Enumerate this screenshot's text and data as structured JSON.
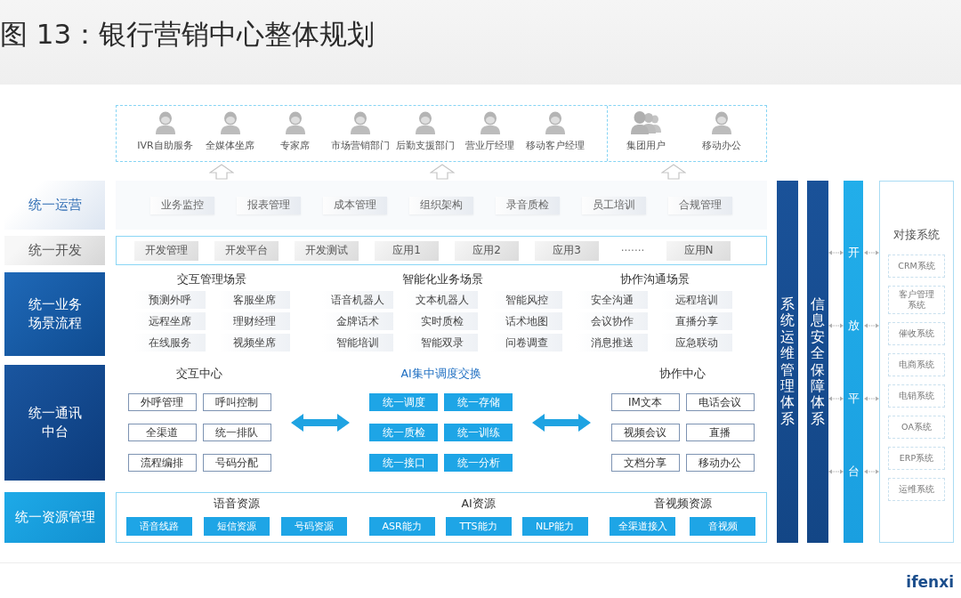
{
  "title": "图 13：银行营销中心整体规划",
  "user_groups": [
    {
      "users": [
        {
          "label": "IVR自助服务",
          "kind": "person"
        },
        {
          "label": "全媒体坐席",
          "kind": "person"
        },
        {
          "label": "专家席",
          "kind": "person"
        },
        {
          "label": "市场营销部门",
          "kind": "person"
        },
        {
          "label": "后勤支援部门",
          "kind": "person"
        },
        {
          "label": "营业厅经理",
          "kind": "person"
        },
        {
          "label": "移动客户经理",
          "kind": "person"
        }
      ]
    },
    {
      "users": [
        {
          "label": "集团用户",
          "kind": "group"
        },
        {
          "label": "移动办公",
          "kind": "person"
        }
      ]
    }
  ],
  "layers": [
    {
      "kind": "ops",
      "label": "统一运营",
      "items": [
        "业务监控",
        "报表管理",
        "成本管理",
        "组织架构",
        "录音质检",
        "员工培训",
        "合规管理"
      ]
    },
    {
      "kind": "dev",
      "label": "统一开发",
      "items": [
        {
          "text": "开发管理",
          "kind": "tile"
        },
        {
          "text": "开发平台",
          "kind": "tile"
        },
        {
          "text": "开发测试",
          "kind": "tile"
        },
        {
          "text": "应用1",
          "kind": "tile"
        },
        {
          "text": "应用2",
          "kind": "tile"
        },
        {
          "text": "应用3",
          "kind": "tile"
        },
        {
          "text": "·······",
          "kind": "gap"
        },
        {
          "text": "应用N",
          "kind": "tile"
        }
      ]
    },
    {
      "kind": "scenes",
      "label": "统一业务场景流程",
      "groups": [
        {
          "title": "交互管理场景",
          "rows": [
            [
              "预测外呼",
              "客服坐席"
            ],
            [
              "远程坐席",
              "理财经理"
            ],
            [
              "在线服务",
              "视频坐席"
            ]
          ]
        },
        {
          "title": "智能化业务场景",
          "rows": [
            [
              "语音机器人",
              "文本机器人",
              "智能风控"
            ],
            [
              "金牌话术",
              "实时质检",
              "话术地图"
            ],
            [
              "智能培训",
              "智能双录",
              "问卷调查"
            ]
          ]
        },
        {
          "title": "协作沟通场景",
          "rows": [
            [
              "安全沟通",
              "远程培训"
            ],
            [
              "会议协作",
              "直播分享"
            ],
            [
              "消息推送",
              "应急联动"
            ]
          ]
        }
      ]
    },
    {
      "kind": "comm",
      "label": "统一通讯中台",
      "groups": [
        {
          "title": "交互中心",
          "kind": "outline",
          "rows": [
            [
              "外呼管理",
              "呼叫控制"
            ],
            [
              "全渠道",
              "统一排队"
            ],
            [
              "流程编排",
              "号码分配"
            ]
          ]
        },
        {
          "title": "AI集中调度交换",
          "kind": "filled",
          "rows": [
            [
              "统一调度",
              "统一存储"
            ],
            [
              "统一质检",
              "统一训练"
            ],
            [
              "统一接口",
              "统一分析"
            ]
          ]
        },
        {
          "title": "协作中心",
          "kind": "outline",
          "rows": [
            [
              "IM文本",
              "电话会议"
            ],
            [
              "视频会议",
              "直播"
            ],
            [
              "文档分享",
              "移动办公"
            ]
          ]
        }
      ]
    },
    {
      "kind": "resources",
      "label": "统一资源管理",
      "groups": [
        {
          "title": "语音资源",
          "items": [
            "语音线路",
            "短信资源",
            "号码资源"
          ]
        },
        {
          "title": "AI资源",
          "items": [
            "ASR能力",
            "TTS能力",
            "NLP能力"
          ]
        },
        {
          "title": "音视频资源",
          "items": [
            "全渠道接入",
            "音视频"
          ]
        }
      ]
    }
  ],
  "side_bars": [
    {
      "kind": "system",
      "label": "系统运维管理体系"
    },
    {
      "kind": "system",
      "label": "信息安全保障体系"
    },
    {
      "kind": "platform",
      "label": "开放平台"
    }
  ],
  "integration": {
    "title": "对接系统",
    "items": [
      "CRM系统",
      "客户管理系统",
      "催收系统",
      "电商系统",
      "电销系统",
      "OA系统",
      "ERP系统",
      "运维系统"
    ]
  },
  "logo": "ifenxi"
}
